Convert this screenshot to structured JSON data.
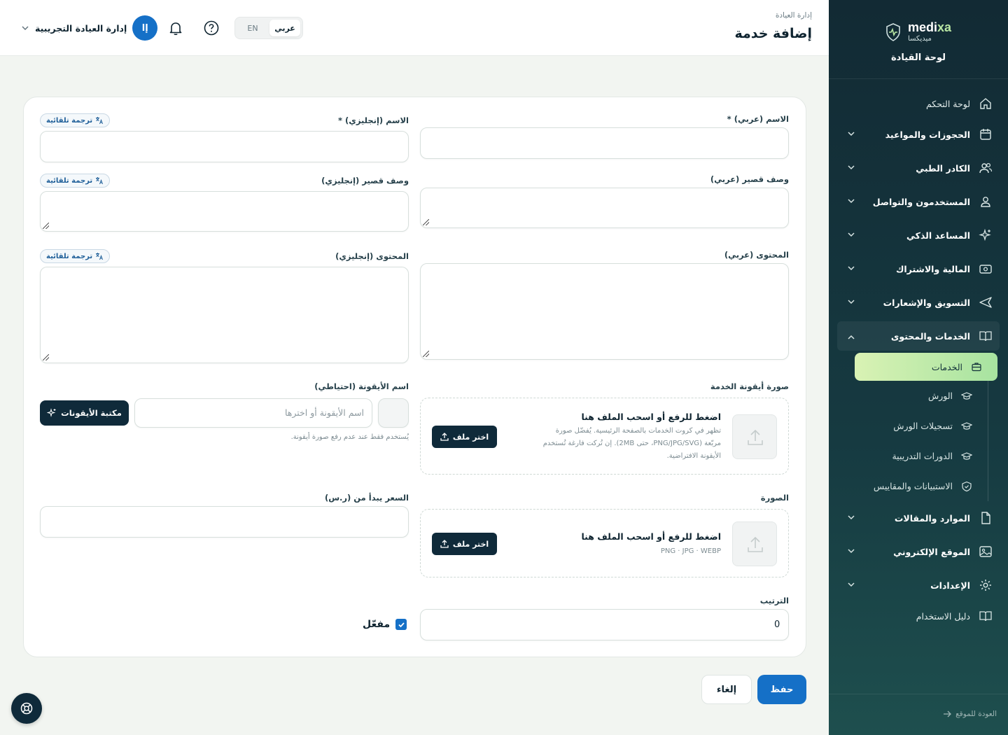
{
  "brand": {
    "name_a": "medi",
    "name_b": "xa",
    "sub": "ميديكسا",
    "title": "لوحة القيادة"
  },
  "nav": [
    {
      "label": "لوحة التحكم",
      "icon": "home-icon"
    },
    {
      "label": "الحجوزات والمواعيد",
      "icon": "calendar-icon"
    },
    {
      "label": "الكادر الطبي",
      "icon": "users-icon"
    },
    {
      "label": "المستخدمون والتواصل",
      "icon": "user-icon"
    },
    {
      "label": "المساعد الذكي",
      "icon": "sparkles-icon"
    },
    {
      "label": "المالية والاشتراك",
      "icon": "money-icon"
    },
    {
      "label": "التسويق والإشعارات",
      "icon": "send-icon"
    },
    {
      "label": "الخدمات والمحتوى",
      "icon": "book-icon"
    },
    {
      "label": "الموارد والمقالات",
      "icon": "file-icon"
    },
    {
      "label": "الموقع الإلكتروني",
      "icon": "image-icon"
    },
    {
      "label": "الإعدادات",
      "icon": "gear-icon"
    },
    {
      "label": "دليل الاستخدام",
      "icon": "book-icon"
    }
  ],
  "subnav": [
    {
      "label": "الخدمات",
      "icon": "briefcase-icon"
    },
    {
      "label": "الورش",
      "icon": "graduation-cap-icon"
    },
    {
      "label": "تسجيلات الورش",
      "icon": "graduation-cap-icon"
    },
    {
      "label": "الدورات التدريبية",
      "icon": "graduation-cap-icon"
    },
    {
      "label": "الاستبيانات والمقاييس",
      "icon": "shield-icon"
    }
  ],
  "back_link": "العودة للموقع",
  "header": {
    "breadcrumb": "إدارة العيادة",
    "title": "إضافة خدمة",
    "lang_ar": "عربي",
    "lang_en": "EN",
    "user_name": "إدارة العيادة التجريبية",
    "avatar": "إا"
  },
  "form": {
    "name_ar_label": "الاسم (عربي) *",
    "name_en_label": "الاسم (إنجليزي) *",
    "short_ar_label": "وصف قصير (عربي)",
    "short_en_label": "وصف قصير (إنجليزي)",
    "content_ar_label": "المحتوى (عربي)",
    "content_en_label": "المحتوى (إنجليزي)",
    "auto_translate": "ترجمة تلقائية",
    "icon_image_label": "صورة أيقونة الخدمة",
    "icon_name_label": "اسم الأيقونة (احتياطي)",
    "icon_name_placeholder": "اسم الأيقونة أو اخترها",
    "icon_library": "مكتبة الأيقونات",
    "icon_name_note": "يُستخدم فقط عند عدم رفع صورة أيقونة.",
    "upload_title": "اضغط للرفع أو اسحب الملف هنا",
    "icon_upload_hint_1": "تظهر في كروت الخدمات بالصفحة الرئيسية. يُفضّل صورة",
    "icon_upload_hint_2": "مربّعة (PNG/JPG/SVG، حتى 2MB). إن تُركت فارغة تُستخدم",
    "icon_upload_hint_3": "الأيقونة الافتراضية.",
    "pick_file": "اختر ملف",
    "image_label": "الصورة",
    "image_upload_hint": "PNG · JPG · WEBP",
    "price_label": "السعر يبدأ من (ر.س)",
    "order_label": "الترتيب",
    "order_value": "0",
    "active_label": "مفعّل"
  },
  "actions": {
    "save": "حفظ",
    "cancel": "إلغاء"
  }
}
